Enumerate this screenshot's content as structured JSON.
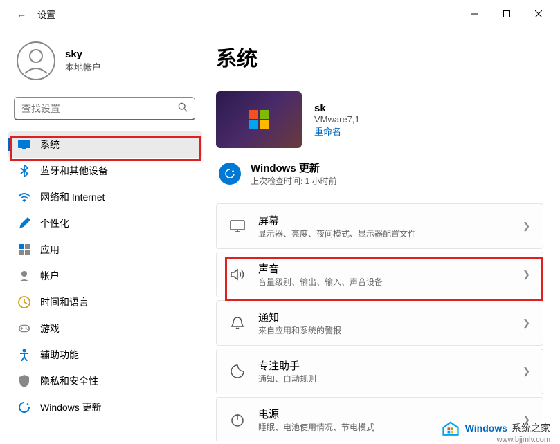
{
  "titlebar": {
    "title": "设置"
  },
  "user": {
    "name": "sky",
    "sub": "本地帐户"
  },
  "search": {
    "placeholder": "查找设置"
  },
  "nav": [
    {
      "label": "系统",
      "icon": "system",
      "active": true
    },
    {
      "label": "蓝牙和其他设备",
      "icon": "bluetooth"
    },
    {
      "label": "网络和 Internet",
      "icon": "network"
    },
    {
      "label": "个性化",
      "icon": "personalize"
    },
    {
      "label": "应用",
      "icon": "apps"
    },
    {
      "label": "帐户",
      "icon": "accounts"
    },
    {
      "label": "时间和语言",
      "icon": "time"
    },
    {
      "label": "游戏",
      "icon": "gaming"
    },
    {
      "label": "辅助功能",
      "icon": "accessibility"
    },
    {
      "label": "隐私和安全性",
      "icon": "privacy"
    },
    {
      "label": "Windows 更新",
      "icon": "update"
    }
  ],
  "pageTitle": "系统",
  "device": {
    "name": "sk",
    "model": "VMware7,1",
    "rename": "重命名"
  },
  "update": {
    "title": "Windows 更新",
    "sub": "上次检查时间: 1 小时前"
  },
  "settings": [
    {
      "key": "display",
      "title": "屏幕",
      "desc": "显示器、亮度、夜间模式、显示器配置文件"
    },
    {
      "key": "sound",
      "title": "声音",
      "desc": "音量级别、输出、输入、声音设备"
    },
    {
      "key": "notifications",
      "title": "通知",
      "desc": "来自应用和系统的警报"
    },
    {
      "key": "focus",
      "title": "专注助手",
      "desc": "通知、自动规则"
    },
    {
      "key": "power",
      "title": "电源",
      "desc": "睡眠、电池使用情况、节电模式"
    }
  ],
  "watermark": {
    "text1": "Windows",
    "text2": " 系统之家",
    "url": "www.bjjmlv.com"
  }
}
